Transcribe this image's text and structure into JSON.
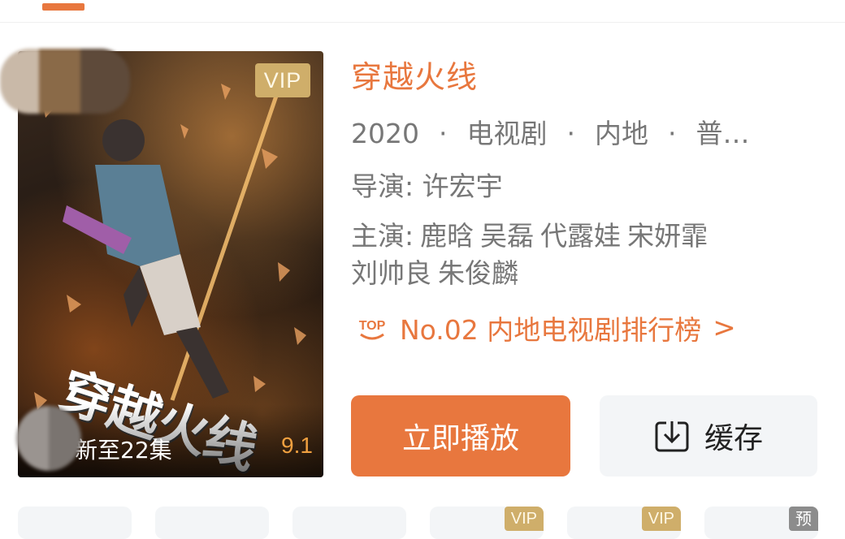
{
  "poster": {
    "vip_badge": "VIP",
    "calligraphy": "穿越火线",
    "update_text": "新至22集",
    "score": "9.1"
  },
  "info": {
    "title": "穿越火线",
    "meta": [
      "2020",
      "电视剧",
      "内地",
      "普…"
    ],
    "director_label": "导演:",
    "director": "许宏宇",
    "cast_label": "主演:",
    "cast": [
      "鹿晗",
      "吴磊",
      "代露娃",
      "宋妍霏",
      "刘帅良",
      "朱俊麟"
    ],
    "rank_badge": "TOP",
    "rank_text": "No.02 内地电视剧排行榜",
    "rank_chevron": ">"
  },
  "actions": {
    "play_label": "立即播放",
    "cache_label": "缓存"
  },
  "episodes": [
    {
      "badge": ""
    },
    {
      "badge": ""
    },
    {
      "badge": ""
    },
    {
      "badge": "VIP"
    },
    {
      "badge": "VIP"
    },
    {
      "badge": "预"
    }
  ],
  "colors": {
    "accent": "#e8773e",
    "vip_gold": "#cfae6a",
    "text_gray": "#777777",
    "button_gray_bg": "#f3f5f7"
  }
}
